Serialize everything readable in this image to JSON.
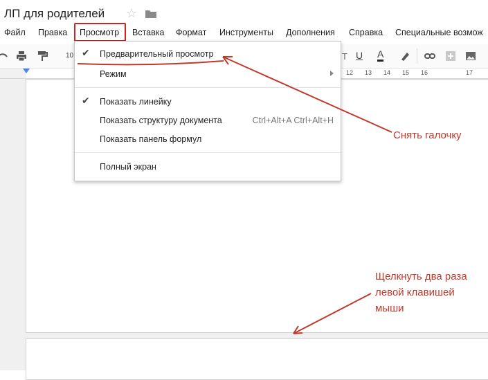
{
  "document": {
    "title": "ЛП для родителей"
  },
  "menubar": {
    "file": "Файл",
    "edit": "Правка",
    "view": "Просмотр",
    "insert": "Вставка",
    "format": "Формат",
    "tools": "Инструменты",
    "addons": "Дополнения",
    "help": "Справка",
    "accessibility": "Специальные возмож"
  },
  "toolbar": {
    "zoom": "10"
  },
  "ruler": {
    "numbers": [
      "12",
      "13",
      "14",
      "15",
      "16",
      "17"
    ]
  },
  "view_menu": {
    "print_layout": {
      "label": "Предварительный просмотр",
      "checked": true
    },
    "mode": {
      "label": "Режим",
      "has_submenu": true
    },
    "show_ruler": {
      "label": "Показать линейку",
      "checked": true
    },
    "show_outline": {
      "label": "Показать структуру документа",
      "shortcut": "Ctrl+Alt+A Ctrl+Alt+H"
    },
    "show_equation_toolbar": {
      "label": "Показать панель формул"
    },
    "full_screen": {
      "label": "Полный экран"
    }
  },
  "annotations": {
    "uncheck_note": "Снять галочку",
    "double_click_note": [
      "Щелкнуть два раза",
      "левой клавишей",
      "мыши"
    ]
  },
  "colors": {
    "annotation": "#c0392b",
    "ruler_marker": "#4a86e8",
    "menu_highlight_box": "#cc2222"
  },
  "icons": [
    "star-icon",
    "folder-icon",
    "undo-icon",
    "print-icon",
    "paint-format-icon",
    "checkmark-icon",
    "submenu-arrow-icon",
    "text-color-icon",
    "highlight-icon",
    "link-icon",
    "comment-icon",
    "image-icon"
  ]
}
